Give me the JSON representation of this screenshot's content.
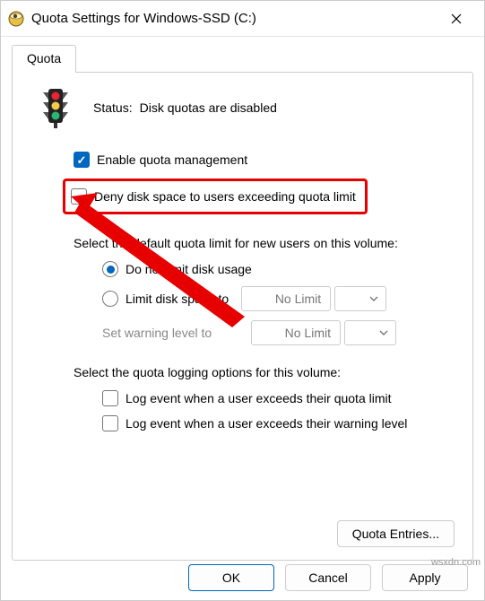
{
  "window": {
    "title": "Quota Settings for Windows-SSD (C:)"
  },
  "tab": {
    "label": "Quota"
  },
  "status": {
    "label": "Status:",
    "value": "Disk quotas are disabled"
  },
  "checks": {
    "enable": "Enable quota management",
    "deny": "Deny disk space to users exceeding quota limit"
  },
  "sections": {
    "default_limit": "Select the default quota limit for new users on this volume:",
    "logging": "Select the quota logging options for this volume:"
  },
  "radios": {
    "no_limit": "Do not limit disk usage",
    "limit_to": "Limit disk space to",
    "warn_to": "Set warning level to"
  },
  "values": {
    "no_limit_text": "No Limit"
  },
  "log_checks": {
    "exceed_limit": "Log event when a user exceeds their quota limit",
    "exceed_warn": "Log event when a user exceeds their warning level"
  },
  "buttons": {
    "entries": "Quota Entries...",
    "ok": "OK",
    "cancel": "Cancel",
    "apply": "Apply"
  },
  "watermark": "wsxdn.com"
}
